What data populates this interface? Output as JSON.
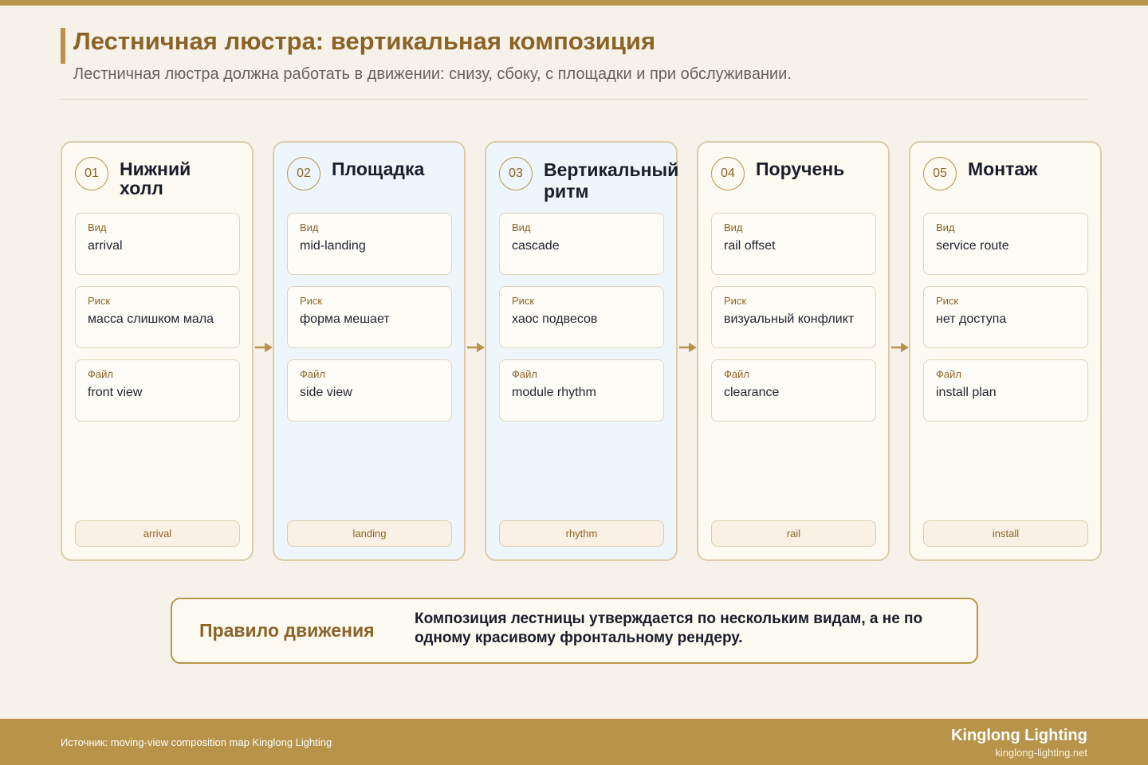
{
  "header": {
    "title": "Лестничная люстра: вертикальная композиция",
    "subtitle": "Лестничная люстра должна работать в движении: снизу, сбоку, с площадки и при обслуживании."
  },
  "stages": [
    {
      "number": "01",
      "title": "Нижний холл",
      "fields": [
        {
          "label": "Вид",
          "value": "arrival"
        },
        {
          "label": "Риск",
          "value": "масса слишком мала"
        },
        {
          "label": "Файл",
          "value": "front view"
        }
      ],
      "tag": "arrival"
    },
    {
      "number": "02",
      "title": "Площадка",
      "fields": [
        {
          "label": "Вид",
          "value": "mid-landing"
        },
        {
          "label": "Риск",
          "value": "форма мешает"
        },
        {
          "label": "Файл",
          "value": "side view"
        }
      ],
      "tag": "landing"
    },
    {
      "number": "03",
      "title": "Вертикальный ритм",
      "fields": [
        {
          "label": "Вид",
          "value": "cascade"
        },
        {
          "label": "Риск",
          "value": "хаос подвесов"
        },
        {
          "label": "Файл",
          "value": "module rhythm"
        }
      ],
      "tag": "rhythm"
    },
    {
      "number": "04",
      "title": "Поручень",
      "fields": [
        {
          "label": "Вид",
          "value": "rail offset"
        },
        {
          "label": "Риск",
          "value": "визуальный конфликт"
        },
        {
          "label": "Файл",
          "value": "clearance"
        }
      ],
      "tag": "rail"
    },
    {
      "number": "05",
      "title": "Монтаж",
      "fields": [
        {
          "label": "Вид",
          "value": "service route"
        },
        {
          "label": "Риск",
          "value": "нет доступа"
        },
        {
          "label": "Файл",
          "value": "install plan"
        }
      ],
      "tag": "install"
    }
  ],
  "rule": {
    "label": "Правило движения",
    "text": "Композиция лестницы утверждается по нескольким видам, а не по одному красивому фронтальному рендеру."
  },
  "footer": {
    "source": "Источник: moving-view composition map Kinglong Lighting",
    "brand": "Kinglong Lighting",
    "url": "kinglong-lighting.net"
  },
  "colors": {
    "accent": "#b8934a",
    "title": "#8c6326",
    "card_blue": "#eef6fc",
    "card_cream": "#fdfaf2"
  },
  "icons": {
    "flow_arrow": "arrow-right-icon"
  }
}
